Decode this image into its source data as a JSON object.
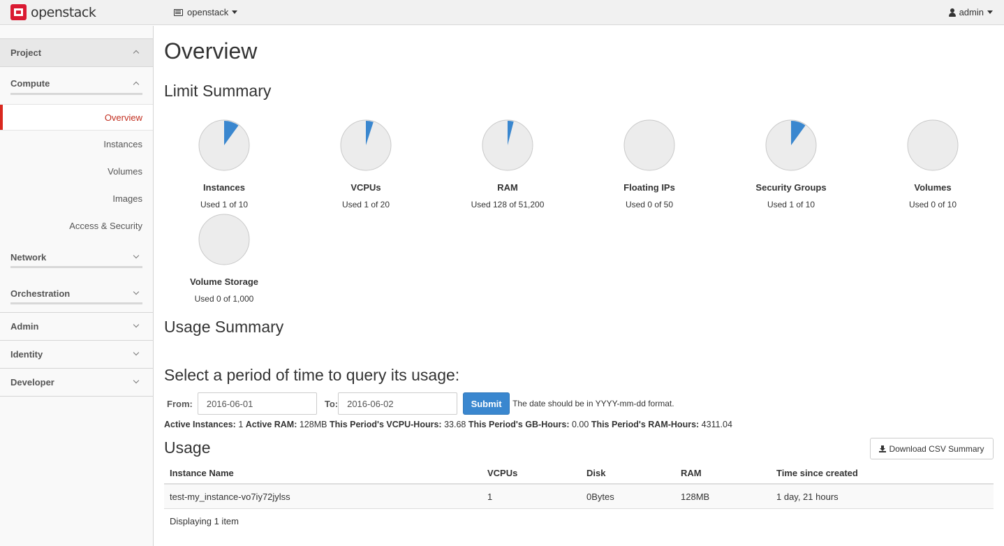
{
  "navbar": {
    "brand": "openstack",
    "project": "openstack",
    "user": "admin"
  },
  "sidebar": {
    "project": "Project",
    "compute": "Compute",
    "compute_items": [
      "Overview",
      "Instances",
      "Volumes",
      "Images",
      "Access & Security"
    ],
    "active_item": "Overview",
    "network": "Network",
    "orchestration": "Orchestration",
    "admin": "Admin",
    "identity": "Identity",
    "developer": "Developer"
  },
  "page": {
    "title": "Overview",
    "limit_summary": "Limit Summary",
    "usage_summary": "Usage Summary"
  },
  "limits": [
    {
      "title": "Instances",
      "text": "Used 1 of 10",
      "used": 1,
      "max": 10
    },
    {
      "title": "VCPUs",
      "text": "Used 1 of 20",
      "used": 1,
      "max": 20
    },
    {
      "title": "RAM",
      "text": "Used 128 of 51,200",
      "used": 128,
      "max": 51200
    },
    {
      "title": "Floating IPs",
      "text": "Used 0 of 50",
      "used": 0,
      "max": 50
    },
    {
      "title": "Security Groups",
      "text": "Used 1 of 10",
      "used": 1,
      "max": 10
    },
    {
      "title": "Volumes",
      "text": "Used 0 of 10",
      "used": 0,
      "max": 10
    },
    {
      "title": "Volume Storage",
      "text": "Used 0 of 1,000",
      "used": 0,
      "max": 1000
    }
  ],
  "colors": {
    "pie_used": "#3a87cf",
    "pie_bg": "#ececec",
    "pie_border": "#c9c9c9",
    "accent": "#d9281f"
  },
  "period": {
    "title": "Select a period of time to query its usage:",
    "from_label": "From:",
    "from_value": "2016-06-01",
    "to_label": "To:",
    "to_value": "2016-06-02",
    "submit": "Submit",
    "hint": "The date should be in YYYY-mm-dd format."
  },
  "totals": {
    "active_instances_label": "Active Instances:",
    "active_instances": "1",
    "active_ram_label": "Active RAM:",
    "active_ram": "128MB",
    "vcpu_hours_label": "This Period's VCPU-Hours:",
    "vcpu_hours": "33.68",
    "gb_hours_label": "This Period's GB-Hours:",
    "gb_hours": "0.00",
    "ram_hours_label": "This Period's RAM-Hours:",
    "ram_hours": "4311.04"
  },
  "usage": {
    "title": "Usage",
    "download": "Download CSV Summary",
    "columns": [
      "Instance Name",
      "VCPUs",
      "Disk",
      "RAM",
      "Time since created"
    ],
    "rows": [
      [
        "test-my_instance-vo7iy72jylss",
        "1",
        "0Bytes",
        "128MB",
        "1 day, 21 hours"
      ]
    ],
    "footer": "Displaying 1 item"
  }
}
